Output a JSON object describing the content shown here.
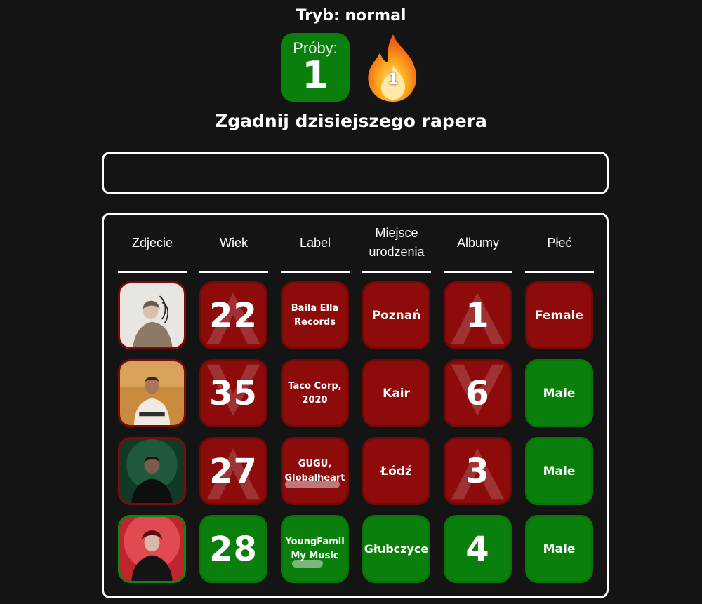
{
  "mode_label": "Tryb: normal",
  "tries": {
    "label": "Próby:",
    "value": "1"
  },
  "streak": {
    "value": "1",
    "icon": "fire-icon"
  },
  "subtitle": "Zgadnij dzisiejszego rapera",
  "search": {
    "value": "",
    "placeholder": ""
  },
  "columns": [
    "Zdjecie",
    "Wiek",
    "Label",
    "Miejsce urodzenia",
    "Albumy",
    "Płeć"
  ],
  "colors": {
    "correct": "#0b7f0b",
    "wrong": "#8d0b0b",
    "background": "#141414"
  },
  "guesses": [
    {
      "photo_status": "wrong",
      "age": {
        "value": "22",
        "status": "wrong",
        "hint": "up"
      },
      "label": {
        "value": "Baila Ella Records",
        "status": "wrong"
      },
      "birthplace": {
        "value": "Poznań",
        "status": "wrong"
      },
      "albums": {
        "value": "1",
        "status": "wrong",
        "hint": "up"
      },
      "gender": {
        "value": "Female",
        "status": "wrong"
      }
    },
    {
      "photo_status": "wrong",
      "age": {
        "value": "35",
        "status": "wrong",
        "hint": "down"
      },
      "label": {
        "value": "Taco Corp, 2020",
        "status": "wrong"
      },
      "birthplace": {
        "value": "Kair",
        "status": "wrong"
      },
      "albums": {
        "value": "6",
        "status": "wrong",
        "hint": "down"
      },
      "gender": {
        "value": "Male",
        "status": "correct"
      }
    },
    {
      "photo_status": "wrong",
      "age": {
        "value": "27",
        "status": "wrong",
        "hint": "up"
      },
      "label": {
        "value": "GUGU, Globalheart",
        "status": "wrong"
      },
      "birthplace": {
        "value": "Łódź",
        "status": "wrong"
      },
      "albums": {
        "value": "3",
        "status": "wrong",
        "hint": "up"
      },
      "gender": {
        "value": "Male",
        "status": "correct"
      }
    },
    {
      "photo_status": "correct",
      "age": {
        "value": "28",
        "status": "correct",
        "hint": ""
      },
      "label": {
        "value": "YoungFamil My Music",
        "status": "correct"
      },
      "birthplace": {
        "value": "Głubczyce",
        "status": "correct"
      },
      "albums": {
        "value": "4",
        "status": "correct",
        "hint": ""
      },
      "gender": {
        "value": "Male",
        "status": "correct"
      }
    }
  ]
}
